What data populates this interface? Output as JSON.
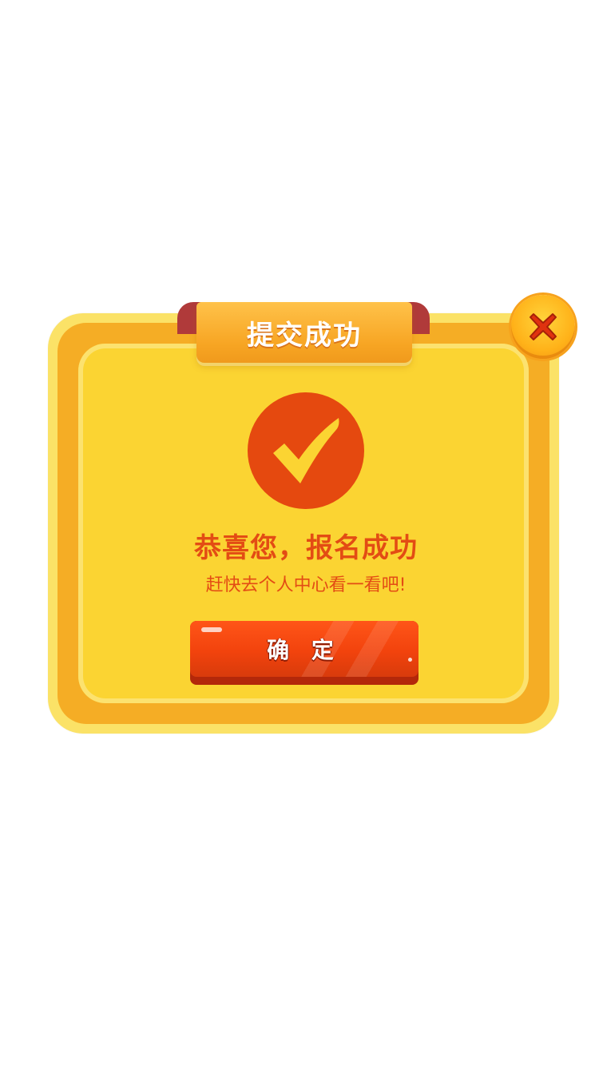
{
  "dialog": {
    "title": "提交成功",
    "close_icon": "close-icon",
    "status_icon": "checkmark-icon",
    "headline": "恭喜您，报名成功",
    "subline": "赶快去个人中心看一看吧!",
    "confirm_label": "确 定"
  },
  "colors": {
    "frame_outer": "#fbe267",
    "frame_orange": "#f5ad25",
    "frame_inner": "#fbd432",
    "accent_red": "#e5490f",
    "text_red": "#e34c14",
    "title_tab": "#f7a523"
  }
}
